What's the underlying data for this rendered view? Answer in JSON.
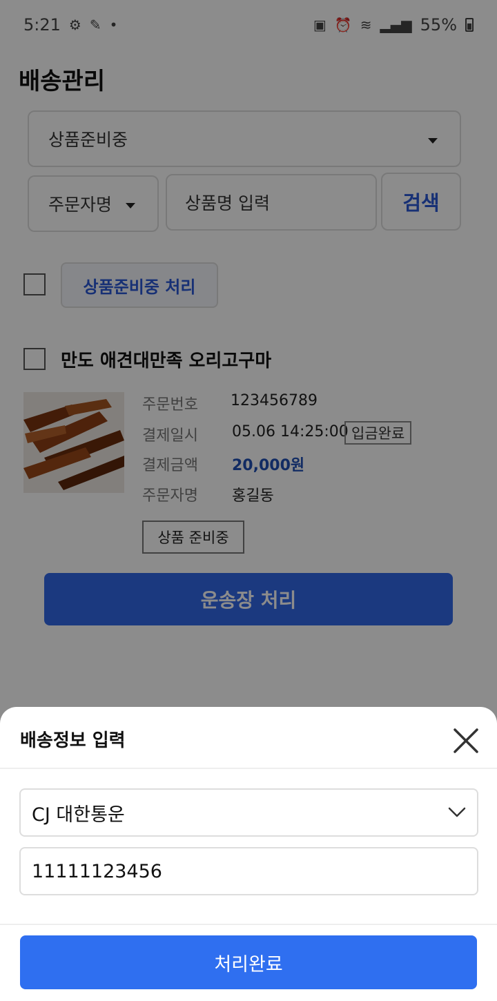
{
  "status_bar": {
    "time": "5:21",
    "battery": "55%"
  },
  "header": {
    "title": "배송관리"
  },
  "filters": {
    "status_selected": "상품준비중",
    "search_type_selected": "주문자명",
    "search_placeholder": "상품명 입력",
    "search_button": "검색"
  },
  "bulk_action": {
    "label": "상품준비중 처리"
  },
  "order": {
    "product_name": "만도 애견대만족 오리고구마",
    "labels": {
      "order_no": "주문번호",
      "paid_at": "결제일시",
      "amount": "결제금액",
      "orderer": "주문자명"
    },
    "order_no": "123456789",
    "paid_at": "05.06 14:25:00",
    "paid_badge": "입금완료",
    "amount": "20,000원",
    "orderer": "홍길동",
    "state": "상품 준비중",
    "waybill_button": "운송장 처리"
  },
  "sheet": {
    "title": "배송정보 입력",
    "carrier_selected": "CJ 대한통운",
    "tracking_number": "11111123456",
    "complete_button": "처리완료"
  },
  "colors": {
    "primary": "#2f6ff0",
    "accent_text": "#2a58d6"
  }
}
